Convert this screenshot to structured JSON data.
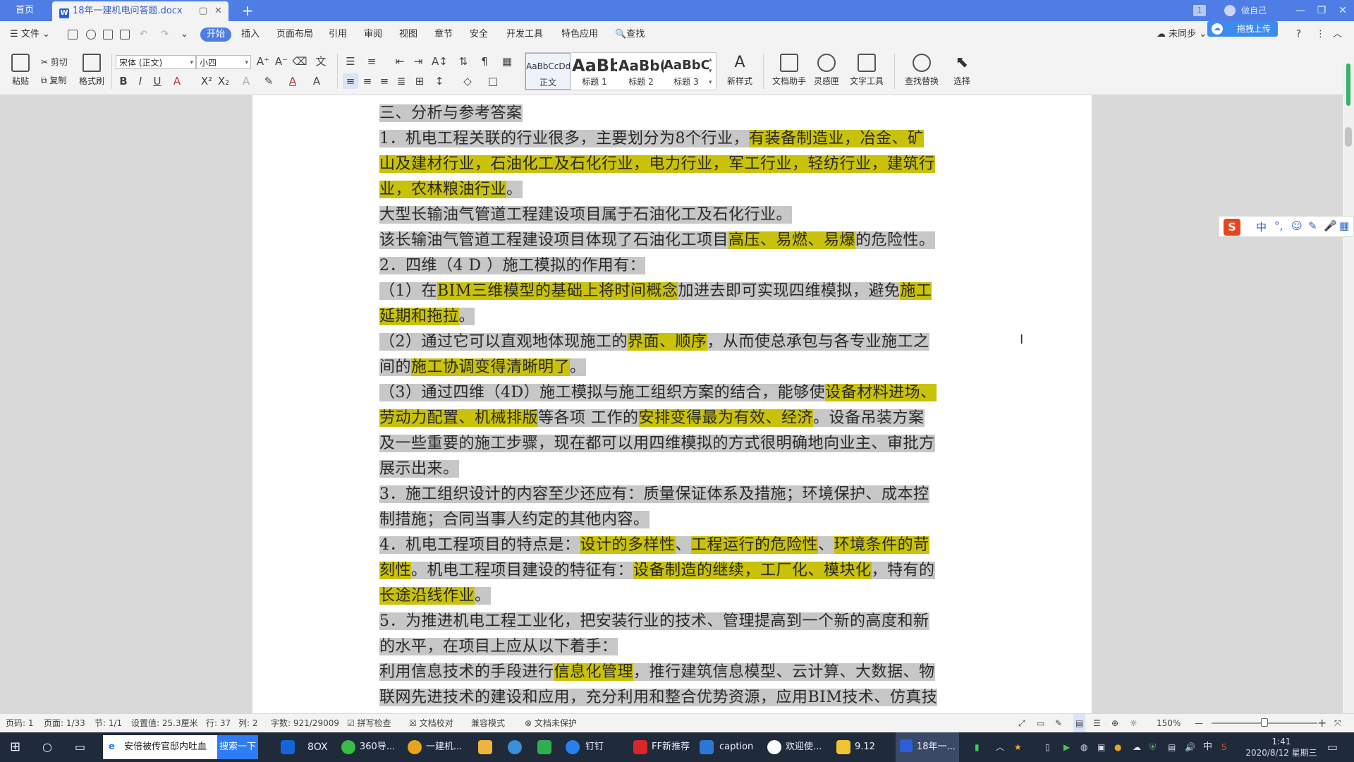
{
  "titlebar": {
    "home_tab": "首页",
    "doc_tab": "18年一建机电问答题.docx",
    "new_tab": "+",
    "badge": "1",
    "user": "做自己",
    "ctl_min": "—",
    "ctl_restore": "❐",
    "ctl_close": "✕"
  },
  "menubar": {
    "file": "文件",
    "items": [
      "开始",
      "插入",
      "页面布局",
      "引用",
      "审阅",
      "视图",
      "章节",
      "安全",
      "开发工具",
      "特色应用"
    ],
    "search": "查找",
    "sync": "未同步",
    "upload": "拖拽上传",
    "help": "?"
  },
  "ribbon": {
    "paste": "粘贴",
    "cut": "剪切",
    "copy": "复制",
    "format_painter": "格式刷",
    "font_name": "宋体 (正文)",
    "font_size": "小四",
    "styles": [
      {
        "preview": "AaBbCcDd",
        "name": "正文"
      },
      {
        "preview": "AaBb",
        "name": "标题 1"
      },
      {
        "preview": "AaBb(",
        "name": "标题 2"
      },
      {
        "preview": "AaBbC",
        "name": "标题 3"
      }
    ],
    "new_style": "新样式",
    "doc_assistant": "文档助手",
    "inspiration": "灵感匣",
    "text_tools": "文字工具",
    "find_replace": "查找替换",
    "select": "选择"
  },
  "document": {
    "lines": [
      [
        {
          "t": "三、分析与参考答案",
          "k": "s"
        }
      ],
      [
        {
          "t": "1．机电工程关联的行业很多，主要划分为8个行业，",
          "k": "s"
        },
        {
          "t": "有装备制造业，冶金、矿",
          "k": "h"
        }
      ],
      [
        {
          "t": "山及建材行业，石油化工及石化行业，电力行业，军工行业，轻纺行业，建筑行",
          "k": "h"
        }
      ],
      [
        {
          "t": "业，农林粮油行业",
          "k": "h"
        },
        {
          "t": "。",
          "k": "s"
        }
      ],
      [
        {
          "t": "大型长输油气管道工程建设项目属于石油化工及石化行业。",
          "k": "s"
        }
      ],
      [
        {
          "t": "该长输油气管道工程建设项目体现了石油化工项目",
          "k": "s"
        },
        {
          "t": "高压、易燃、易爆",
          "k": "h"
        },
        {
          "t": "的危险性。",
          "k": "s"
        }
      ],
      [
        {
          "t": "2．四维（4 D ）施工模拟的作用有：",
          "k": "s"
        }
      ],
      [
        {
          "t": "（1）在",
          "k": "s"
        },
        {
          "t": "BIM三维模型的基础上将时间概念",
          "k": "h"
        },
        {
          "t": "加进去即可实现四维模拟，避免",
          "k": "s"
        },
        {
          "t": "施工",
          "k": "h"
        }
      ],
      [
        {
          "t": "延期和拖拉",
          "k": "h"
        },
        {
          "t": "。",
          "k": "s"
        }
      ],
      [
        {
          "t": "（2）通过它可以直观地体现施工的",
          "k": "s"
        },
        {
          "t": "界面、顺序",
          "k": "h"
        },
        {
          "t": "，从而使总承包与各专业施工之",
          "k": "s"
        }
      ],
      [
        {
          "t": "间的",
          "k": "s"
        },
        {
          "t": "施工协调变得清晰明了",
          "k": "h"
        },
        {
          "t": "。",
          "k": "s"
        }
      ],
      [
        {
          "t": "（3）通过四维（4D）施工模拟与施工组织方案的结合，能够使",
          "k": "s"
        },
        {
          "t": "设备材料进场、",
          "k": "h"
        }
      ],
      [
        {
          "t": "劳动力配置、机械排版",
          "k": "h"
        },
        {
          "t": "等各项 工作的",
          "k": "s"
        },
        {
          "t": "安排变得最为有效、经济",
          "k": "h"
        },
        {
          "t": "。设备吊装方案",
          "k": "s"
        }
      ],
      [
        {
          "t": "及一些重要的施工步骤，现在都可以用四维模拟的方式很明确地向业主、审批方",
          "k": "s"
        }
      ],
      [
        {
          "t": "展示出来。",
          "k": "s"
        }
      ],
      [
        {
          "t": "3．施工组织设计的内容至少还应有：质量保证体系及措施；环境保护、成本控",
          "k": "s"
        }
      ],
      [
        {
          "t": "制措施；合同当事人约定的其他内容。",
          "k": "s"
        }
      ],
      [
        {
          "t": "4．机电工程项目的特点是：",
          "k": "s"
        },
        {
          "t": "设计的多样性",
          "k": "h"
        },
        {
          "t": "、",
          "k": "s"
        },
        {
          "t": "工程运行的危险性",
          "k": "h"
        },
        {
          "t": "、",
          "k": "s"
        },
        {
          "t": "环境条件的苛",
          "k": "h"
        }
      ],
      [
        {
          "t": "刻性",
          "k": "h"
        },
        {
          "t": "。机电工程项目建设的特征有：",
          "k": "s"
        },
        {
          "t": "设备制造的继续，工厂化、模块化",
          "k": "h"
        },
        {
          "t": "，特有的",
          "k": "s"
        }
      ],
      [
        {
          "t": "长途沿线作业",
          "k": "h"
        },
        {
          "t": "。",
          "k": "s"
        }
      ],
      [
        {
          "t": "5．为推进机电工程工业化，把安装行业的技术、管理提高到一个新的高度和新",
          "k": "s"
        }
      ],
      [
        {
          "t": "的水平，在项目上应从以下着手：",
          "k": "s"
        }
      ],
      [
        {
          "t": "利用信息技术的手段进行",
          "k": "s"
        },
        {
          "t": "信息化管理",
          "k": "h"
        },
        {
          "t": "，推行建筑信息模型、云计算、大数据、物",
          "k": "s"
        }
      ],
      [
        {
          "t": "联网先进技术的建设和应用，充分利用和整合优势资源，应用BIM技术、仿真技",
          "k": "s"
        }
      ],
      [
        {
          "t": "术、优化技术、虚拟建造技术，积极推广应用建筑业新技术’，切实提高项目信",
          "k": "s"
        }
      ]
    ]
  },
  "ime": {
    "items": [
      "中",
      "°,",
      "☺",
      "✎",
      "🎤",
      "▦"
    ]
  },
  "statusbar": {
    "page_num": "页码: 1",
    "pages": "页面: 1/33",
    "section": "节: 1/1",
    "setting": "设置值: 25.3厘米",
    "row": "行: 37",
    "col": "列: 2",
    "word_count": "字数: 921/29009",
    "spell": "拼写检查",
    "proof": "文档校对",
    "compat": "兼容模式",
    "protect": "文档未保护",
    "zoom": "150%",
    "zoom_minus": "—",
    "zoom_plus": "+"
  },
  "taskbar": {
    "browser_item": "安倍被传官邸内吐血",
    "search_go": "搜索一下",
    "apps": [
      "360导...",
      "一建机...",
      "钉钉",
      "FF新推荐",
      "caption",
      "欢迎使...",
      "9.12",
      "18年一..."
    ],
    "ime_tray": "中",
    "time": "1:41",
    "date": "2020/8/12 星期三"
  }
}
